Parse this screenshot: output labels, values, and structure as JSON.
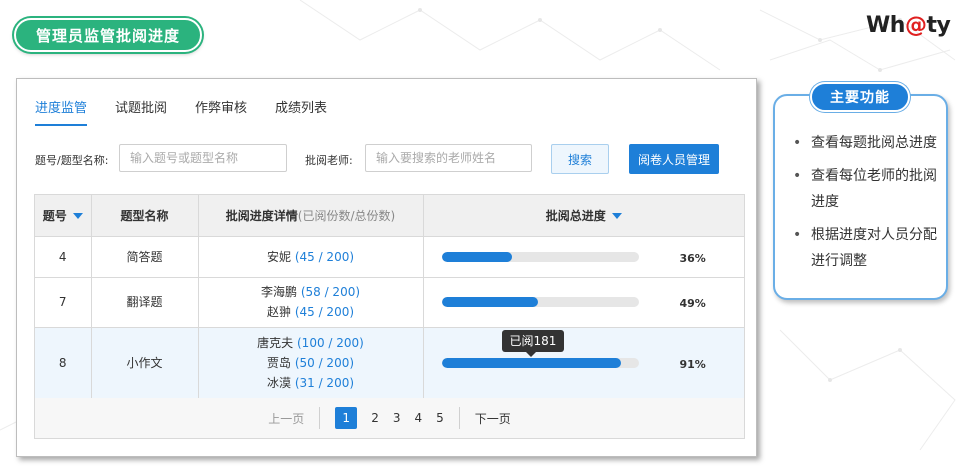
{
  "page_title": "管理员监管批阅进度",
  "logo": {
    "pre": "Wh",
    "at": "@",
    "post": "ty"
  },
  "tabs": [
    "进度监管",
    "试题批阅",
    "作弊审核",
    "成绩列表"
  ],
  "filters": {
    "question_label": "题号/题型名称:",
    "question_placeholder": "输入题号或题型名称",
    "teacher_label": "批阅老师:",
    "teacher_placeholder": "输入要搜索的老师姓名",
    "search_button": "搜索",
    "manage_button": "阅卷人员管理"
  },
  "table": {
    "headers": {
      "num": "题号",
      "type": "题型名称",
      "detail": "批阅进度详情",
      "detail_sub": "(已阅份数/总份数)",
      "total": "批阅总进度"
    },
    "rows": [
      {
        "num": "4",
        "type": "简答题",
        "teachers": [
          {
            "name": "安妮",
            "count": "(45 / 200)"
          }
        ],
        "progress": 0.36,
        "pct": "36%"
      },
      {
        "num": "7",
        "type": "翻译题",
        "teachers": [
          {
            "name": "李海鹏",
            "count": "(58 / 200)"
          },
          {
            "name": "赵翀",
            "count": "(45 / 200)"
          }
        ],
        "progress": 0.49,
        "pct": "49%"
      },
      {
        "num": "8",
        "type": "小作文",
        "teachers": [
          {
            "name": "唐克夫",
            "count": "(100 / 200)"
          },
          {
            "name": "贾岛",
            "count": "(50 / 200)"
          },
          {
            "name": "冰漠",
            "count": "(31 / 200)"
          }
        ],
        "progress": 0.91,
        "pct": "91%",
        "tooltip": "已阅181"
      }
    ]
  },
  "pagination": {
    "prev": "上一页",
    "pages": [
      "1",
      "2",
      "3",
      "4",
      "5"
    ],
    "current": "1",
    "next": "下一页"
  },
  "features": {
    "title": "主要功能",
    "items": [
      "查看每题批阅总进度",
      "查看每位老师的批阅进度",
      "根据进度对人员分配进行调整"
    ]
  },
  "colors": {
    "accent": "#1e7fd8",
    "title_green": "#2bb37e",
    "logo_at": "#e02020"
  }
}
